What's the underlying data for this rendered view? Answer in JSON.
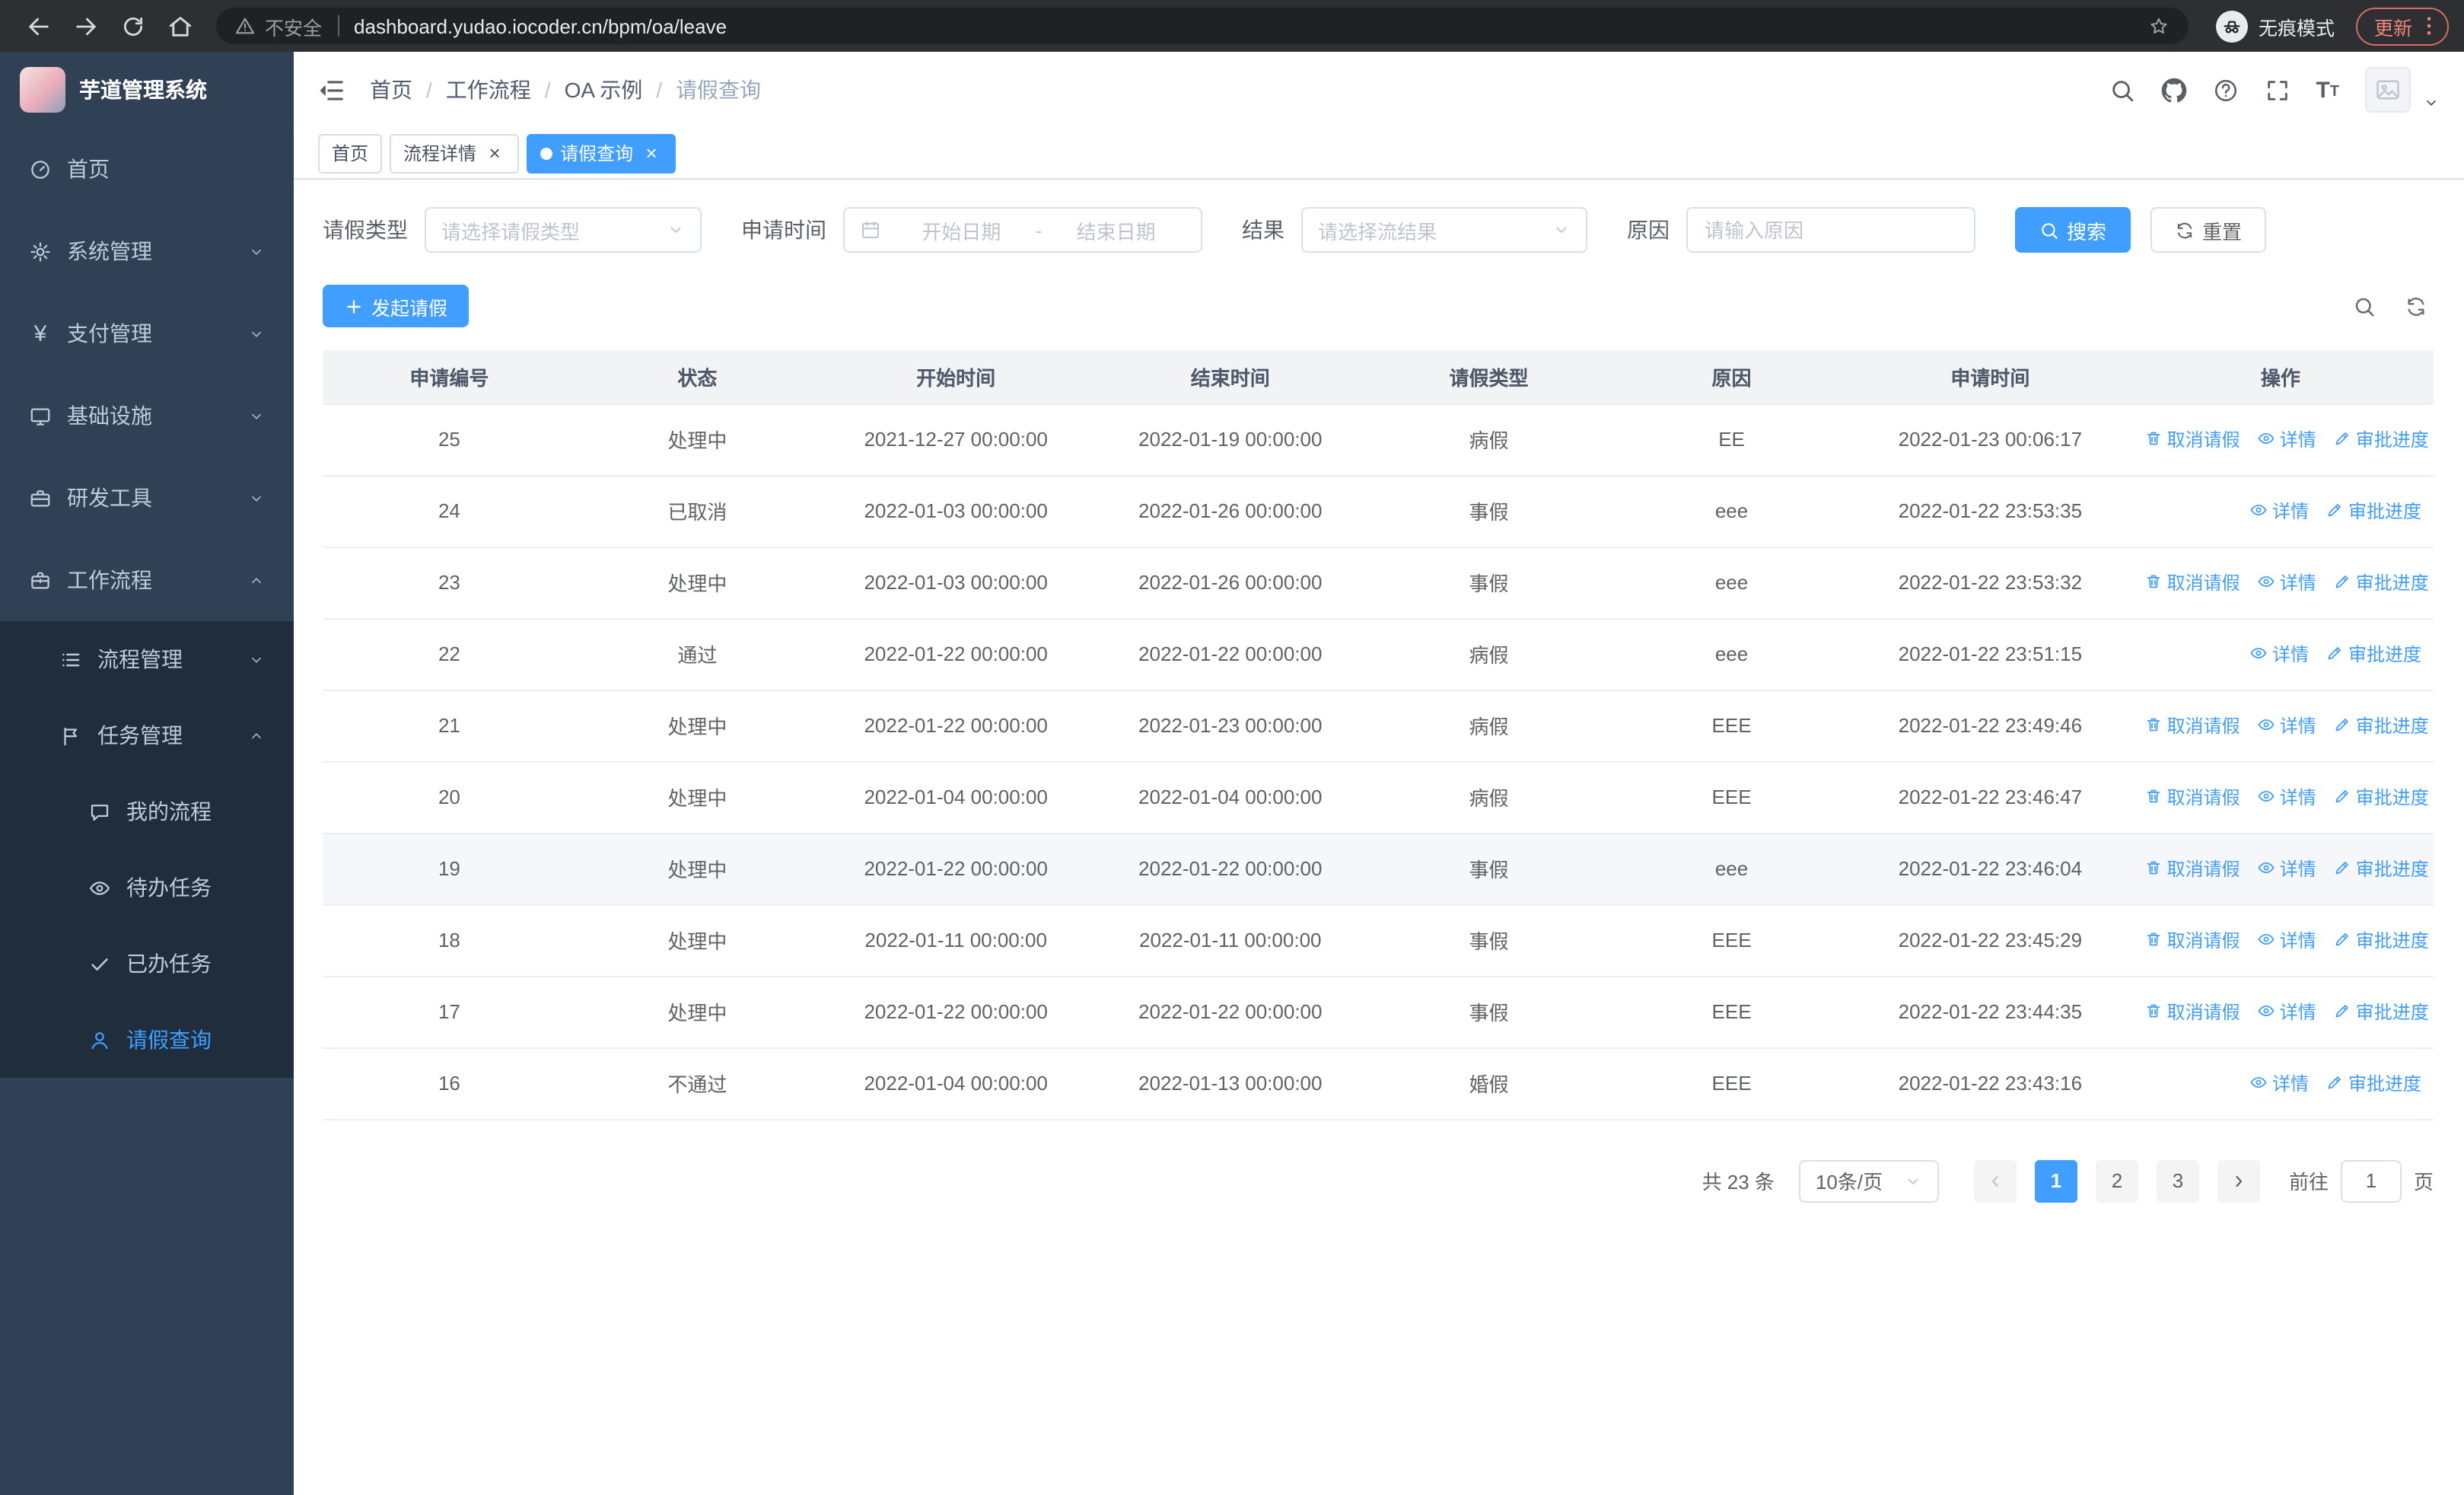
{
  "colors": {
    "accent": "#409eff",
    "sidebar_bg": "#304156",
    "sidebar_submenu_bg": "#1f2d3d",
    "sidebar_text": "#bfcbd9",
    "browser_bar_bg": "#2d2f33",
    "table_header_bg": "#f2f3f5",
    "update_chip": "#f08579"
  },
  "browser": {
    "security_label": "不安全",
    "url": "dashboard.yudao.iocoder.cn/bpm/oa/leave",
    "incognito_label": "无痕模式",
    "update_label": "更新"
  },
  "sidebar": {
    "logo_title": "芋道管理系统",
    "items": [
      {
        "name": "home",
        "label": "首页",
        "icon": "dashboard-icon",
        "level": 1,
        "chevron": null,
        "active": false
      },
      {
        "name": "system-management",
        "label": "系统管理",
        "icon": "gear-icon",
        "level": 1,
        "chevron": "down",
        "active": false
      },
      {
        "name": "payment-management",
        "label": "支付管理",
        "icon": "yen-icon",
        "level": 1,
        "chevron": "down",
        "active": false
      },
      {
        "name": "infrastructure",
        "label": "基础设施",
        "icon": "monitor-icon",
        "level": 1,
        "chevron": "down",
        "active": false
      },
      {
        "name": "dev-tools",
        "label": "研发工具",
        "icon": "toolbox-icon",
        "level": 1,
        "chevron": "down",
        "active": false
      },
      {
        "name": "workflow",
        "label": "工作流程",
        "icon": "briefcase-icon",
        "level": 1,
        "chevron": "up",
        "active": false
      },
      {
        "name": "process-management",
        "label": "流程管理",
        "icon": "list-icon",
        "level": 2,
        "chevron": "down",
        "active": false
      },
      {
        "name": "task-management",
        "label": "任务管理",
        "icon": "flag-icon",
        "level": 2,
        "chevron": "up",
        "active": false
      },
      {
        "name": "my-process",
        "label": "我的流程",
        "icon": "chat-icon",
        "level": 3,
        "chevron": null,
        "active": false
      },
      {
        "name": "todo-tasks",
        "label": "待办任务",
        "icon": "eye-icon",
        "level": 3,
        "chevron": null,
        "active": false
      },
      {
        "name": "done-tasks",
        "label": "已办任务",
        "icon": "check-icon",
        "level": 3,
        "chevron": null,
        "active": false
      },
      {
        "name": "leave-query",
        "label": "请假查询",
        "icon": "user-icon",
        "level": 3,
        "chevron": null,
        "active": true
      }
    ]
  },
  "header": {
    "breadcrumb": [
      "首页",
      "工作流程",
      "OA 示例",
      "请假查询"
    ]
  },
  "tabs": [
    {
      "name": "home",
      "label": "首页",
      "closable": false,
      "active": false
    },
    {
      "name": "process-detail",
      "label": "流程详情",
      "closable": true,
      "active": false
    },
    {
      "name": "leave-query",
      "label": "请假查询",
      "closable": true,
      "active": true
    }
  ],
  "filters": {
    "leave_type_label": "请假类型",
    "leave_type_placeholder": "请选择请假类型",
    "apply_time_label": "申请时间",
    "start_date_placeholder": "开始日期",
    "range_separator": "-",
    "end_date_placeholder": "结束日期",
    "result_label": "结果",
    "result_placeholder": "请选择流结果",
    "reason_label": "原因",
    "reason_placeholder": "请输入原因",
    "search_label": "搜索",
    "reset_label": "重置"
  },
  "toolbar": {
    "create_label": "发起请假"
  },
  "table": {
    "columns": [
      "申请编号",
      "状态",
      "开始时间",
      "结束时间",
      "请假类型",
      "原因",
      "申请时间",
      "操作"
    ],
    "action_labels": {
      "cancel": "取消请假",
      "detail": "详情",
      "progress": "审批进度"
    },
    "rows": [
      {
        "no": "25",
        "status": "处理中",
        "start": "2021-12-27 00:00:00",
        "end": "2022-01-19 00:00:00",
        "type": "病假",
        "reason": "EE",
        "applied": "2022-01-23 00:06:17",
        "actions": [
          "cancel",
          "detail",
          "progress"
        ],
        "highlighted": false
      },
      {
        "no": "24",
        "status": "已取消",
        "start": "2022-01-03 00:00:00",
        "end": "2022-01-26 00:00:00",
        "type": "事假",
        "reason": "eee",
        "applied": "2022-01-22 23:53:35",
        "actions": [
          "detail",
          "progress"
        ],
        "highlighted": false
      },
      {
        "no": "23",
        "status": "处理中",
        "start": "2022-01-03 00:00:00",
        "end": "2022-01-26 00:00:00",
        "type": "事假",
        "reason": "eee",
        "applied": "2022-01-22 23:53:32",
        "actions": [
          "cancel",
          "detail",
          "progress"
        ],
        "highlighted": false
      },
      {
        "no": "22",
        "status": "通过",
        "start": "2022-01-22 00:00:00",
        "end": "2022-01-22 00:00:00",
        "type": "病假",
        "reason": "eee",
        "applied": "2022-01-22 23:51:15",
        "actions": [
          "detail",
          "progress"
        ],
        "highlighted": false
      },
      {
        "no": "21",
        "status": "处理中",
        "start": "2022-01-22 00:00:00",
        "end": "2022-01-23 00:00:00",
        "type": "病假",
        "reason": "EEE",
        "applied": "2022-01-22 23:49:46",
        "actions": [
          "cancel",
          "detail",
          "progress"
        ],
        "highlighted": false
      },
      {
        "no": "20",
        "status": "处理中",
        "start": "2022-01-04 00:00:00",
        "end": "2022-01-04 00:00:00",
        "type": "病假",
        "reason": "EEE",
        "applied": "2022-01-22 23:46:47",
        "actions": [
          "cancel",
          "detail",
          "progress"
        ],
        "highlighted": false
      },
      {
        "no": "19",
        "status": "处理中",
        "start": "2022-01-22 00:00:00",
        "end": "2022-01-22 00:00:00",
        "type": "事假",
        "reason": "eee",
        "applied": "2022-01-22 23:46:04",
        "actions": [
          "cancel",
          "detail",
          "progress"
        ],
        "highlighted": true
      },
      {
        "no": "18",
        "status": "处理中",
        "start": "2022-01-11 00:00:00",
        "end": "2022-01-11 00:00:00",
        "type": "事假",
        "reason": "EEE",
        "applied": "2022-01-22 23:45:29",
        "actions": [
          "cancel",
          "detail",
          "progress"
        ],
        "highlighted": false
      },
      {
        "no": "17",
        "status": "处理中",
        "start": "2022-01-22 00:00:00",
        "end": "2022-01-22 00:00:00",
        "type": "事假",
        "reason": "EEE",
        "applied": "2022-01-22 23:44:35",
        "actions": [
          "cancel",
          "detail",
          "progress"
        ],
        "highlighted": false
      },
      {
        "no": "16",
        "status": "不通过",
        "start": "2022-01-04 00:00:00",
        "end": "2022-01-13 00:00:00",
        "type": "婚假",
        "reason": "EEE",
        "applied": "2022-01-22 23:43:16",
        "actions": [
          "detail",
          "progress"
        ],
        "highlighted": false
      }
    ]
  },
  "pagination": {
    "total_label": "共 23 条",
    "page_size_label": "10条/页",
    "pages": [
      "1",
      "2",
      "3"
    ],
    "active_page": "1",
    "goto_label": "前往",
    "goto_value": "1",
    "page_unit_label": "页"
  }
}
